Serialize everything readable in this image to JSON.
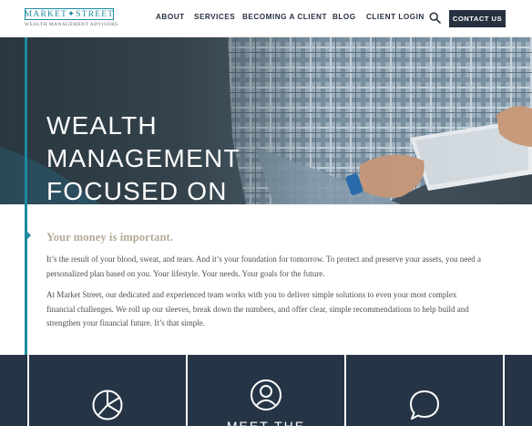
{
  "brand": {
    "name": "MARKET✦STREET",
    "tagline": "WEALTH MANAGEMENT ADVISORS",
    "accent_color": "#1f8aa0",
    "navy_color": "#263140"
  },
  "nav": {
    "items": [
      "ABOUT",
      "SERVICES",
      "BECOMING A CLIENT",
      "BLOG",
      "CLIENT LOGIN"
    ],
    "search_icon": "search-icon",
    "cta_label": "CONTACT US"
  },
  "hero": {
    "title": "WEALTH MANAGEMENT FOCUSED ON YOU"
  },
  "intro": {
    "heading": "Your money is important.",
    "paragraph1": "It’s the result of your blood, sweat, and tears. And it’s your foundation for tomorrow. To protect and preserve your assets, you need a personalized plan based on you. Your lifestyle. Your needs. Your goals for the future.",
    "paragraph2": "At Market Street, our dedicated and experienced team works with you to deliver simple solutions to even your most complex financial challenges. We roll up our sleeves, break down the numbers, and offer clear, simple recommendations to help build and strengthen your financial future. It’s that simple."
  },
  "cards": [
    {
      "icon": "pie-chart-icon",
      "title": ""
    },
    {
      "icon": "user-icon",
      "title": "MEET THE"
    },
    {
      "icon": "chat-bubble-icon",
      "title": ""
    }
  ]
}
